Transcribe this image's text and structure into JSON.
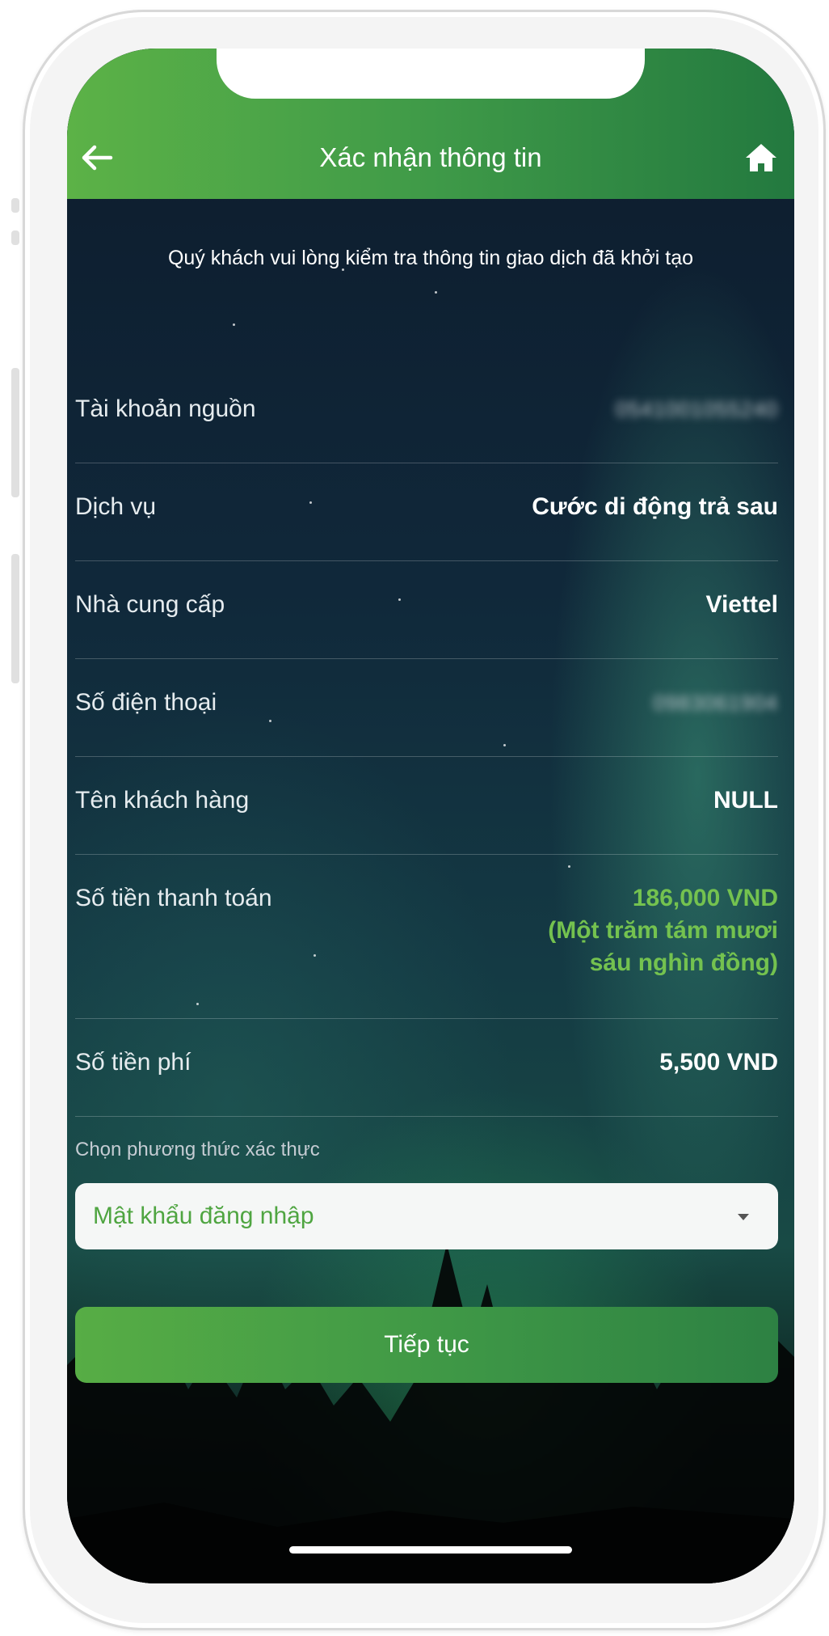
{
  "header": {
    "title": "Xác nhận thông tin"
  },
  "icons": {
    "back": "arrow-left-icon",
    "home": "home-icon"
  },
  "intro_text": "Quý khách vui lòng kiểm tra thông tin giao dịch đã khởi tạo",
  "details": {
    "source_account": {
      "label": "Tài khoản nguồn",
      "value": "0541001055240"
    },
    "service": {
      "label": "Dịch vụ",
      "value": "Cước di động trả sau"
    },
    "provider": {
      "label": "Nhà cung cấp",
      "value": "Viettel"
    },
    "phone": {
      "label": "Số điện thoại",
      "value": "0983061904"
    },
    "customer_name": {
      "label": "Tên khách hàng",
      "value": "NULL"
    },
    "amount": {
      "label": "Số tiền thanh toán",
      "value": "186,000 VND",
      "in_words": "(Một trăm tám mươi sáu nghìn đồng)"
    },
    "fee": {
      "label": "Số tiền phí",
      "value": "5,500 VND"
    }
  },
  "auth": {
    "label": "Chọn phương thức xác thực",
    "selected": "Mật khẩu đăng nhập"
  },
  "continue_label": "Tiếp tục",
  "colors": {
    "brand_green": "#3f9a48",
    "amount_green": "#74c24f"
  }
}
